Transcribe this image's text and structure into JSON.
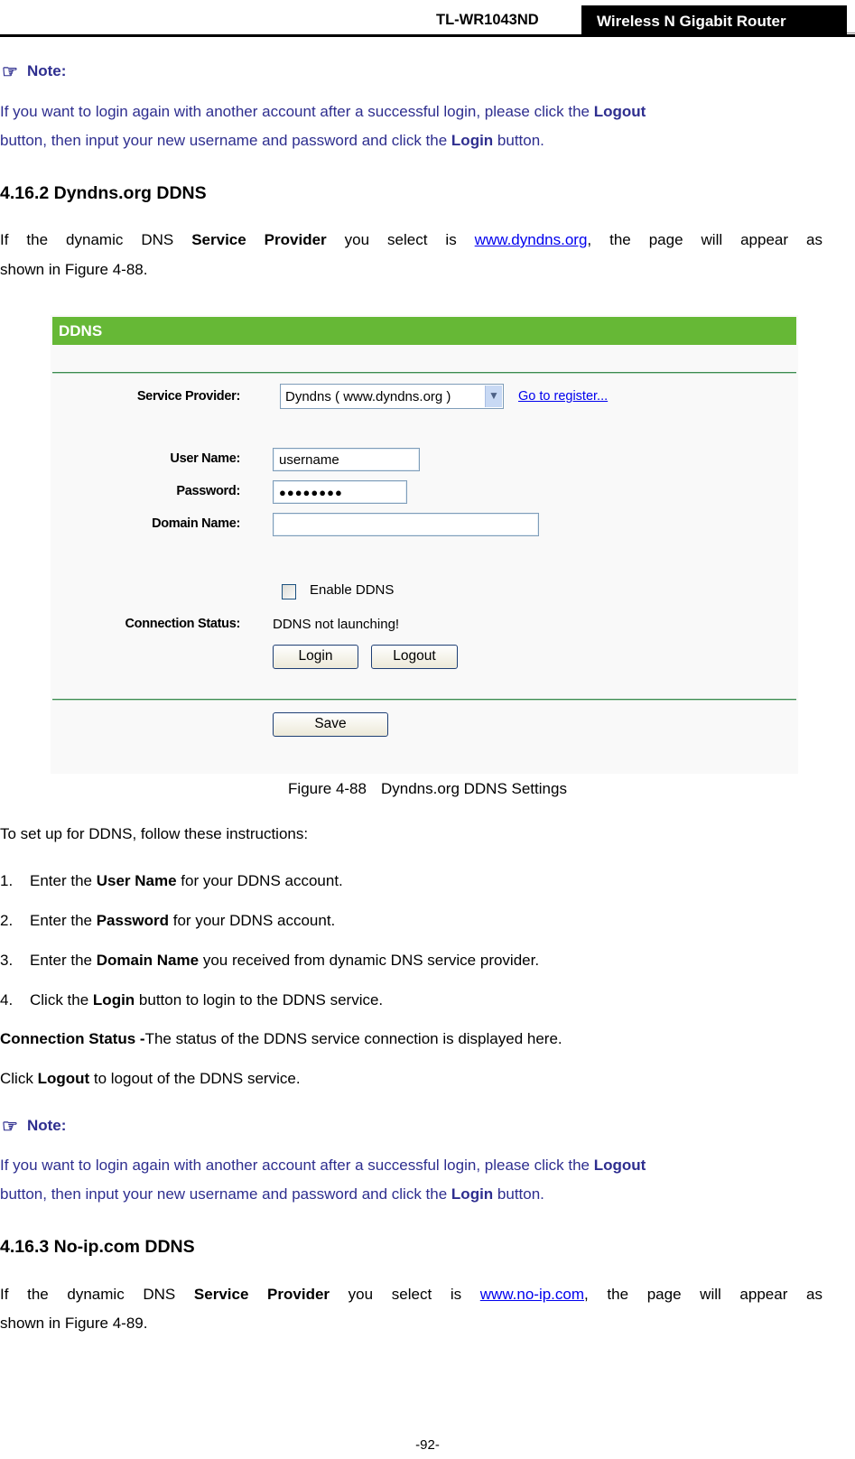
{
  "header": {
    "model": "TL-WR1043ND",
    "product": "Wireless N Gigabit Router"
  },
  "note1": {
    "icon": "pointing-hand-icon",
    "title": "Note:",
    "line1_pre": " If you want to login again with another account after a successful login, please click the ",
    "line1_bold": "Logout",
    "line2_pre": "button, then input your new username and password and click the ",
    "line2_bold": "Login",
    "line2_post": " button."
  },
  "section1": {
    "heading": "4.16.2  Dyndns.org DDNS",
    "para_pre": "If the dynamic DNS ",
    "para_bold": "Service Provider",
    "para_mid": " you select is ",
    "para_link": "www.dyndns.org",
    "para_post": ", the page will appear as",
    "para_line2": "shown in Figure 4-88."
  },
  "figure": {
    "title": "DDNS",
    "service_provider_label": "Service Provider:",
    "service_provider_value": "Dyndns ( www.dyndns.org )",
    "register_link": "Go to register...",
    "username_label": "User Name:",
    "username_value": "username",
    "password_label": "Password:",
    "password_value": "●●●●●●●●",
    "domain_label": "Domain Name:",
    "domain_value": "",
    "enable_ddns_label": "Enable DDNS",
    "enable_ddns_checked": false,
    "connection_status_label": "Connection Status:",
    "connection_status_value": "DDNS not launching!",
    "login_button": "Login",
    "logout_button": "Logout",
    "save_button": "Save",
    "colors": {
      "title_bar": "#66b836",
      "divider": "#3b8a50"
    }
  },
  "caption": {
    "number": "Figure 4-88",
    "text": "Dyndns.org DDNS Settings"
  },
  "instructions": {
    "intro": "To set up for DDNS, follow these instructions:",
    "steps": [
      {
        "num": "1.",
        "pre": "Enter the ",
        "bold": "User Name",
        "post": " for your DDNS account."
      },
      {
        "num": "2.",
        "pre": "Enter the ",
        "bold": "Password",
        "post": " for your DDNS account."
      },
      {
        "num": "3.",
        "pre": "Enter the ",
        "bold": "Domain Name",
        "post": " you received from dynamic DNS service provider."
      },
      {
        "num": "4.",
        "pre": "Click the ",
        "bold": "Login",
        "post": " button to login to the DDNS service."
      }
    ],
    "status_bold": "Connection Status -",
    "status_text": "The status of the DDNS service connection is displayed here.",
    "logout_pre": "Click ",
    "logout_bold": "Logout",
    "logout_post": " to logout of the DDNS service."
  },
  "note2": {
    "icon": "pointing-hand-icon",
    "title": "Note:",
    "line1_pre": " If you want to login again with another account after a successful login, please click the ",
    "line1_bold": "Logout",
    "line2_pre": "button, then input your new username and password and click the ",
    "line2_bold": "Login",
    "line2_post": " button."
  },
  "section2": {
    "heading": "4.16.3  No-ip.com DDNS",
    "para_pre": "If the dynamic DNS ",
    "para_bold": "Service Provider",
    "para_mid": " you select is ",
    "para_link": "www.no-ip.com",
    "para_post": ", the page will appear as",
    "para_line2": "shown in Figure 4-89."
  },
  "footer": {
    "page_number": "-92-"
  }
}
